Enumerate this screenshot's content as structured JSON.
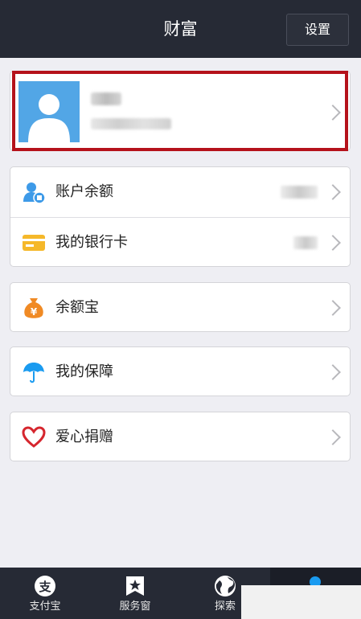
{
  "header": {
    "title": "财富",
    "settings_label": "设置"
  },
  "menu": {
    "group1": [
      {
        "label": "账户余额",
        "icon": "account-balance-icon"
      },
      {
        "label": "我的银行卡",
        "icon": "bank-card-icon"
      }
    ],
    "group2": [
      {
        "label": "余额宝",
        "icon": "money-bag-icon"
      }
    ],
    "group3": [
      {
        "label": "我的保障",
        "icon": "umbrella-icon"
      }
    ],
    "group4": [
      {
        "label": "爱心捐赠",
        "icon": "heart-icon"
      }
    ]
  },
  "tabbar": {
    "tabs": [
      {
        "label": "支付宝",
        "icon": "alipay-icon"
      },
      {
        "label": "服务窗",
        "icon": "star-icon"
      },
      {
        "label": "探索",
        "icon": "globe-icon"
      },
      {
        "label": "",
        "icon": "user-icon"
      }
    ]
  },
  "colors": {
    "header_bg": "#262a35",
    "highlight": "#b5121b",
    "avatar": "#52a6e6",
    "accent_blue": "#1a9bf0"
  }
}
